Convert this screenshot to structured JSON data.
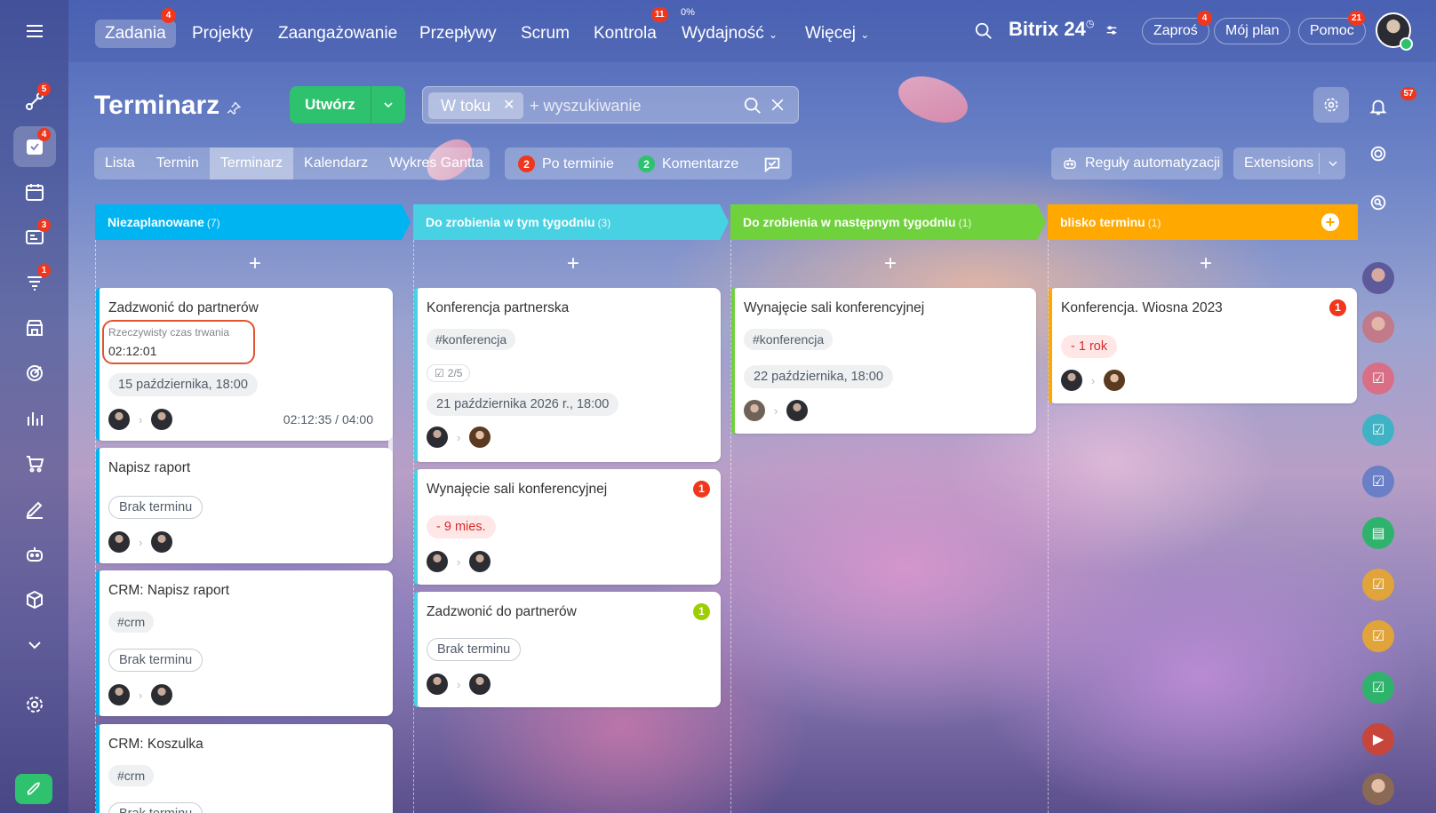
{
  "topnav": {
    "items": [
      {
        "label": "Zadania",
        "badge": "4"
      },
      {
        "label": "Projekty"
      },
      {
        "label": "Zaangażowanie"
      },
      {
        "label": "Przepływy"
      },
      {
        "label": "Scrum"
      },
      {
        "label": "Kontrola",
        "badge": "11"
      },
      {
        "label": "Wydajność",
        "pct": "0%"
      },
      {
        "label": "Więcej"
      }
    ],
    "brand": "Bitrix 24",
    "invite": {
      "label": "Zaproś",
      "badge": "4"
    },
    "plan": "Mój plan",
    "help": {
      "label": "Pomoc",
      "badge": "21"
    }
  },
  "leftnav": {
    "badges": {
      "feed": "5",
      "tasks": "4",
      "crm": "3",
      "funnel": "1"
    }
  },
  "header": {
    "title": "Terminarz",
    "create_label": "Utwórz",
    "filter_chip": "W toku",
    "search_placeholder": "+ wyszukiwanie"
  },
  "view_tabs": [
    "Lista",
    "Termin",
    "Terminarz",
    "Kalendarz",
    "Wykres Gantta"
  ],
  "counters": {
    "overdue": {
      "count": "2",
      "label": "Po terminie"
    },
    "comments": {
      "count": "2",
      "label": "Komentarze"
    }
  },
  "automation_label": "Reguły automatyzacji",
  "extensions_label": "Extensions",
  "notifications_badge": "57",
  "colors": {
    "col1": "#00b4f1",
    "col2": "#47d1e2",
    "col3": "#6fd13b",
    "col4": "#ffa900",
    "green": "#2fc26e",
    "red": "#f0371d",
    "lime": "#9dcf00"
  },
  "columns": [
    {
      "title": "Niezaplanowane",
      "count": "(7)"
    },
    {
      "title": "Do zrobienia w tym tygodniu",
      "count": "(3)"
    },
    {
      "title": "Do zrobienia w następnym tygodniu",
      "count": "(1)"
    },
    {
      "title": "blisko terminu",
      "count": "(1)"
    }
  ],
  "cards": {
    "c1": {
      "title": "Zadzwonić do partnerów",
      "elapsed_label": "Rzeczywisty czas trwania",
      "elapsed_value": "02:12:01",
      "deadline": "15 października, 18:00",
      "timer": "02:12:35 / 04:00"
    },
    "c2": {
      "title": "Napisz raport",
      "deadline": "Brak terminu"
    },
    "c3": {
      "title": "CRM: Napisz raport",
      "tag": "#crm",
      "deadline": "Brak terminu"
    },
    "c4": {
      "title": "CRM: Koszulka",
      "tag": "#crm",
      "deadline": "Brak terminu"
    },
    "c5": {
      "title": "Konferencja partnerska",
      "tag": "#konferencja",
      "checklist": "2/5",
      "deadline": "21 października 2026 r., 18:00"
    },
    "c6": {
      "title": "Wynajęcie sali konferencyjnej",
      "badge": "1",
      "deadline": "- 9 mies."
    },
    "c7": {
      "title": "Zadzwonić do partnerów",
      "badge": "1",
      "deadline": "Brak terminu"
    },
    "c8": {
      "title": "Wynajęcie sali konferencyjnej",
      "tag": "#konferencja",
      "deadline": "22 października, 18:00"
    },
    "c9": {
      "title": "Konferencja. Wiosna 2023",
      "badge": "1",
      "deadline": "- 1 rok"
    }
  }
}
